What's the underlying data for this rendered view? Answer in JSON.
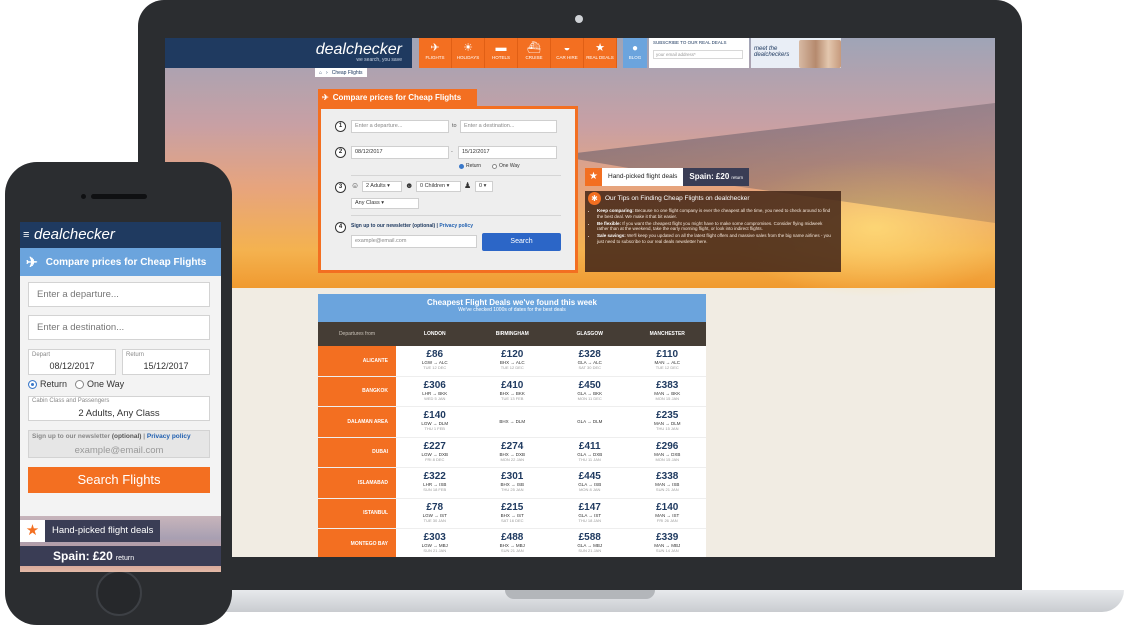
{
  "desktop": {
    "logo": "dealchecker",
    "tagline": "we search, you save",
    "nav": [
      {
        "label": "FLIGHTS",
        "icon": "plane-icon",
        "glyph": "✈"
      },
      {
        "label": "HOLIDAYS",
        "icon": "palm-tree-icon",
        "glyph": "☀"
      },
      {
        "label": "HOTELS",
        "icon": "bed-icon",
        "glyph": "▬"
      },
      {
        "label": "CRUISE",
        "icon": "ship-icon",
        "glyph": "⛴"
      },
      {
        "label": "CAR HIRE",
        "icon": "car-icon",
        "glyph": "◒"
      },
      {
        "label": "REAL DEALS",
        "icon": "star-icon",
        "glyph": "★"
      }
    ],
    "blog": "BLOG",
    "newsletter_title": "SUBSCRIBE TO OUR REAL DEALS",
    "newsletter_placeholder": "your email address*",
    "meet": "meet the dealcheckers",
    "breadcrumb": "Cheap Flights",
    "search": {
      "title": "Compare prices for Cheap Flights",
      "steps": [
        "1",
        "2",
        "3",
        "4"
      ],
      "departure_placeholder": "Enter a departure...",
      "to": "to",
      "destination_placeholder": "Enter a destination...",
      "date_from": "08/12/2017",
      "dash": "-",
      "date_to": "15/12/2017",
      "return": "Return",
      "one_way": "One Way",
      "adults": "2 Adults",
      "children": "0 Children",
      "infants": "0",
      "class": "Any Class",
      "newsletter_label": "Sign up to our newsletter (optional) |",
      "privacy": "Privacy policy",
      "email_placeholder": "example@email.com",
      "button": "Search"
    },
    "handpicked": {
      "label": "Hand-picked flight deals",
      "deal_dest": "Spain:",
      "deal_price": "£20",
      "deal_suffix": "return"
    },
    "tips": {
      "title": "Our Tips on Finding Cheap Flights on dealchecker",
      "items": [
        {
          "b": "Keep comparing:",
          "t": " Because no one flight company is ever the cheapest all the time, you need to check around to find the best deal. We make it that bit easier."
        },
        {
          "b": "Be flexible:",
          "t": " If you want the cheapest flight you might have to make some compromises. Consider flying midweek rather than at the weekend, take the early morning flight, or look into indirect flights."
        },
        {
          "b": "Sale savings:",
          "t": " We'll keep you updated on all the latest flight offers and massive sales from the big name airlines - you just need to subscribe to our real deals newsletter here."
        }
      ]
    },
    "deals": {
      "title": "Cheapest Flight Deals we've found this week",
      "subtitle": "We've checked 1000s of dates for the best deals",
      "departures_label": "Departures from",
      "cities": [
        "LONDON",
        "BIRMINGHAM",
        "GLASGOW",
        "MANCHESTER"
      ],
      "rows": [
        {
          "dest": "ALICANTE",
          "cells": [
            {
              "price": "£86",
              "route": "LGW → ALC",
              "date": "TUE 12 DEC"
            },
            {
              "price": "£120",
              "route": "BHX → ALC",
              "date": "TUE 12 DEC"
            },
            {
              "price": "£328",
              "route": "GLA → ALC",
              "date": "SAT 30 DEC"
            },
            {
              "price": "£110",
              "route": "MAN → ALC",
              "date": "TUE 12 DEC"
            }
          ]
        },
        {
          "dest": "BANGKOK",
          "cells": [
            {
              "price": "£306",
              "route": "LHR → BKK",
              "date": "WED 5 JAN"
            },
            {
              "price": "£410",
              "route": "BHX → BKK",
              "date": "TUE 13 FEB"
            },
            {
              "price": "£450",
              "route": "GLA → BKK",
              "date": "MON 11 DEC"
            },
            {
              "price": "£383",
              "route": "MAN → BKK",
              "date": "MON 15 JAN"
            }
          ]
        },
        {
          "dest": "DALAMAN AREA",
          "cells": [
            {
              "price": "£140",
              "route": "LGW → DLM",
              "date": "THU 1 FEB"
            },
            {
              "price": "",
              "route": "BHX → DLM",
              "date": ""
            },
            {
              "price": "",
              "route": "GLA → DLM",
              "date": ""
            },
            {
              "price": "£235",
              "route": "MAN → DLM",
              "date": "THU 15 JAN"
            }
          ]
        },
        {
          "dest": "DUBAI",
          "cells": [
            {
              "price": "£227",
              "route": "LGW → DXB",
              "date": "FRI 8 DEC"
            },
            {
              "price": "£274",
              "route": "BHX → DXB",
              "date": "MON 22 JAN"
            },
            {
              "price": "£411",
              "route": "GLA → DXB",
              "date": "THU 11 JAN"
            },
            {
              "price": "£296",
              "route": "MAN → DXB",
              "date": "MON 15 JAN"
            }
          ]
        },
        {
          "dest": "ISLAMABAD",
          "cells": [
            {
              "price": "£322",
              "route": "LHR → ISB",
              "date": "SUN 18 FEB"
            },
            {
              "price": "£301",
              "route": "BHX → ISB",
              "date": "THU 25 JAN"
            },
            {
              "price": "£445",
              "route": "GLA → ISB",
              "date": "MON 8 JAN"
            },
            {
              "price": "£338",
              "route": "MAN → ISB",
              "date": "SUN 21 JAN"
            }
          ]
        },
        {
          "dest": "ISTANBUL",
          "cells": [
            {
              "price": "£78",
              "route": "LGW → IST",
              "date": "TUE 30 JAN"
            },
            {
              "price": "£215",
              "route": "BHX → IST",
              "date": "SAT 16 DEC"
            },
            {
              "price": "£147",
              "route": "GLA → IST",
              "date": "THU 18 JAN"
            },
            {
              "price": "£140",
              "route": "MAN → IST",
              "date": "FRI 26 JAN"
            }
          ]
        },
        {
          "dest": "MONTEGO BAY",
          "cells": [
            {
              "price": "£303",
              "route": "LGW → MBJ",
              "date": "SUN 21 JAN"
            },
            {
              "price": "£488",
              "route": "BHX → MBJ",
              "date": "SUN 21 JAN"
            },
            {
              "price": "£588",
              "route": "GLA → MBJ",
              "date": "SUN 21 JAN"
            },
            {
              "price": "£339",
              "route": "MAN → MBJ",
              "date": "SUN 14 JAN"
            }
          ]
        }
      ]
    }
  },
  "mobile": {
    "logo": "dealchecker",
    "title": "Compare prices for Cheap Flights",
    "departure_placeholder": "Enter a departure...",
    "destination_placeholder": "Enter a destination...",
    "depart_label": "Depart",
    "depart_value": "08/12/2017",
    "return_label": "Return",
    "return_value": "15/12/2017",
    "radio_return": "Return",
    "radio_one_way": "One Way",
    "cabin_label": "Cabin Class and Passengers",
    "cabin_value": "2 Adults, Any Class",
    "newsletter_label": "Sign up to our newsletter",
    "newsletter_optional": "(optional)",
    "newsletter_sep": "|",
    "privacy": "Privacy policy",
    "email_placeholder": "example@email.com",
    "button": "Search Flights",
    "handpicked": "Hand-picked flight deals",
    "deal_dest": "Spain:",
    "deal_price": "£20",
    "deal_suffix": "return"
  },
  "colors": {
    "navy": "#1f3a60",
    "orange": "#f36f21",
    "sky": "#6ba4dd",
    "button_blue": "#2c66c7"
  }
}
